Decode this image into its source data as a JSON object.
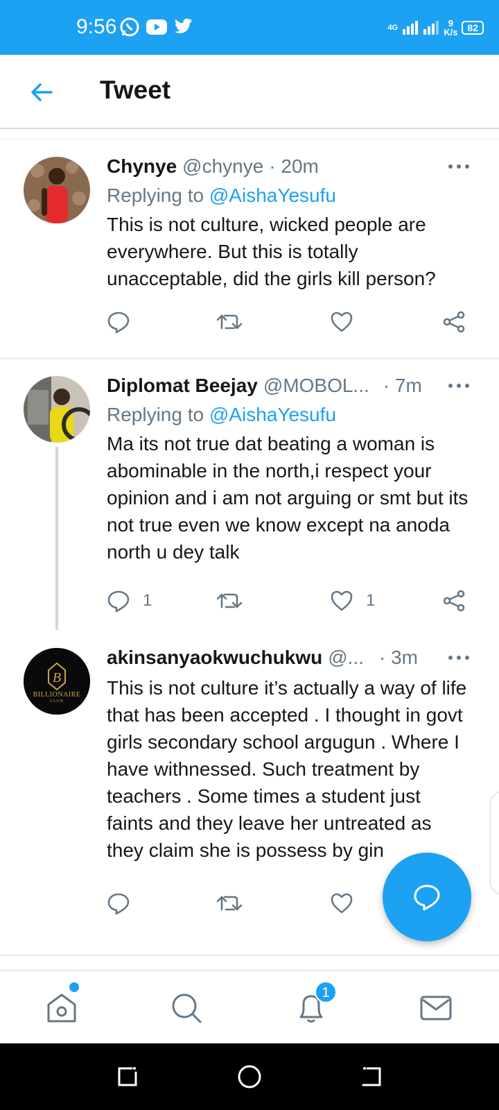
{
  "status_bar": {
    "time": "9:56",
    "network": "4G",
    "speed_value": "9",
    "speed_unit": "K/s",
    "battery": "82"
  },
  "app_bar": {
    "title": "Tweet"
  },
  "tweets": [
    {
      "name": "Chynye",
      "handle": "@chynye",
      "time": "· 20m",
      "replying_prefix": "Replying to ",
      "replying_to": "@AishaYesufu",
      "text": "This is not culture, wicked people are everywhere. But this is totally unacceptable, did the girls kill person?",
      "reply_count": "",
      "retweet_count": "",
      "like_count": ""
    },
    {
      "name": "Diplomat Beejay",
      "handle": "@MOBOL...",
      "time": "· 7m",
      "replying_prefix": "Replying to ",
      "replying_to": "@AishaYesufu",
      "text": "Ma its not true dat beating a woman is abominable in the north,i respect your opinion and i am not arguing or smt but its not true even we know except na anoda north u dey talk",
      "reply_count": "1",
      "retweet_count": "",
      "like_count": "1"
    },
    {
      "name": "akinsanyaokwuchukwu",
      "handle": "@...",
      "time": "· 3m",
      "text": "This is not culture it’s actually a way of life that has been accepted . I thought in govt girls secondary school argugun . Where I have withnessed. Such treatment by teachers . Some times a student just faints and they leave her untreated as they claim she is possess by gin",
      "avatar_text": "BILLIONAIRE",
      "avatar_sub": "CLUB",
      "reply_count": "",
      "retweet_count": "",
      "like_count": ""
    }
  ],
  "bottom_nav": {
    "notifications_badge": "1"
  },
  "colors": {
    "brand": "#1da1f2",
    "muted": "#657786",
    "text": "#14171a"
  }
}
